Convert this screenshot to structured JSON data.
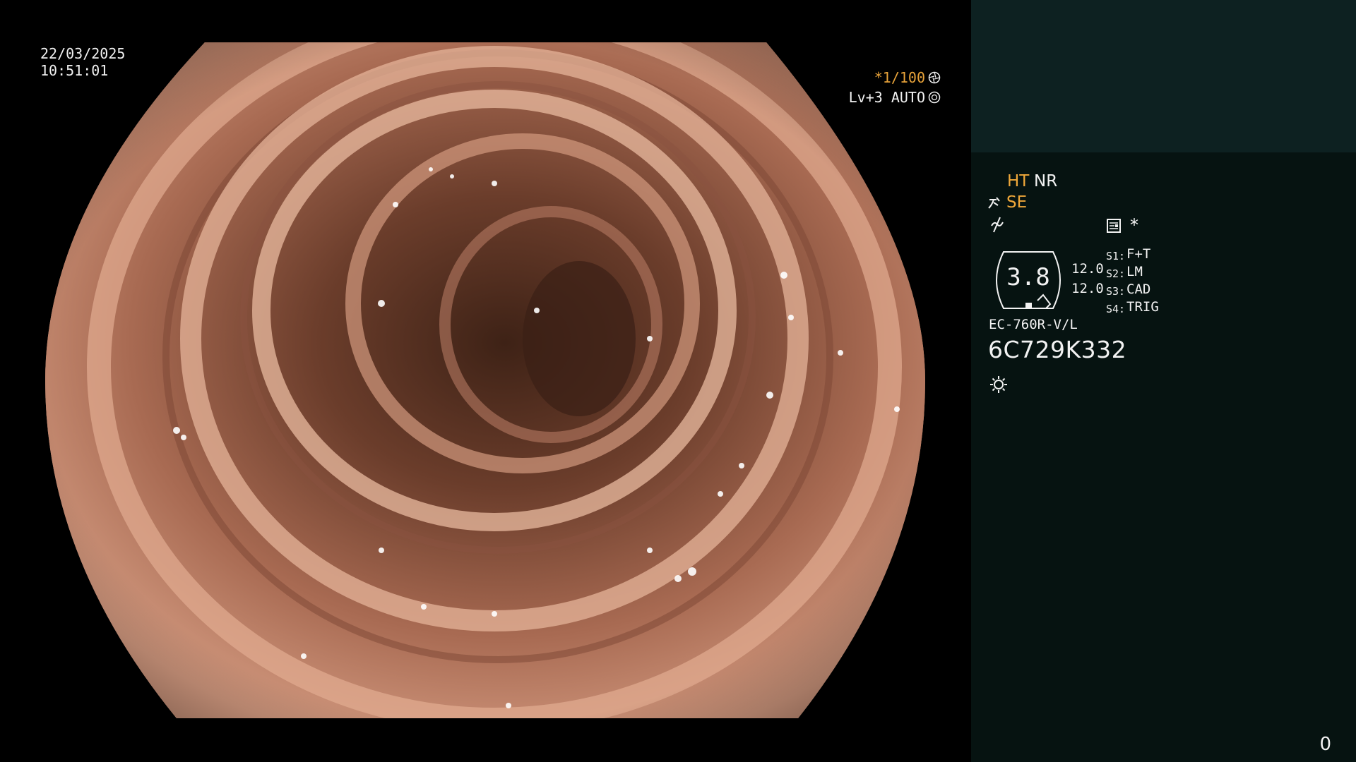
{
  "osd": {
    "date": "22/03/2025",
    "time": "10:51:01",
    "shutter": "*1/100",
    "level": "Lv+3 AUTO",
    "shutter_icon": "aperture-icon",
    "level_icon": "iris-icon"
  },
  "panel": {
    "ht": "HT",
    "nr": "NR",
    "se": "SE",
    "se_icon": "structure-enhancement-icon",
    "noise_icon": "noise-reduction-icon",
    "doc_icon": "document-icon",
    "star": "*",
    "dial_value": "3.8",
    "value_1": "12.0",
    "value_2": "12.0",
    "switches": [
      {
        "label": "S1:",
        "value": "F+T"
      },
      {
        "label": "S2:",
        "value": "LM"
      },
      {
        "label": "S3:",
        "value": "CAD"
      },
      {
        "label": "S4:",
        "value": "TRIG"
      }
    ],
    "model": "EC-760R-V/L",
    "serial": "6C729K332",
    "light_icon": "sun-icon",
    "counter": "0"
  },
  "colors": {
    "accent": "#f0a83a",
    "panel_bg": "#061311",
    "panel_top": "#0d2121",
    "tissue": "#c98a72"
  }
}
